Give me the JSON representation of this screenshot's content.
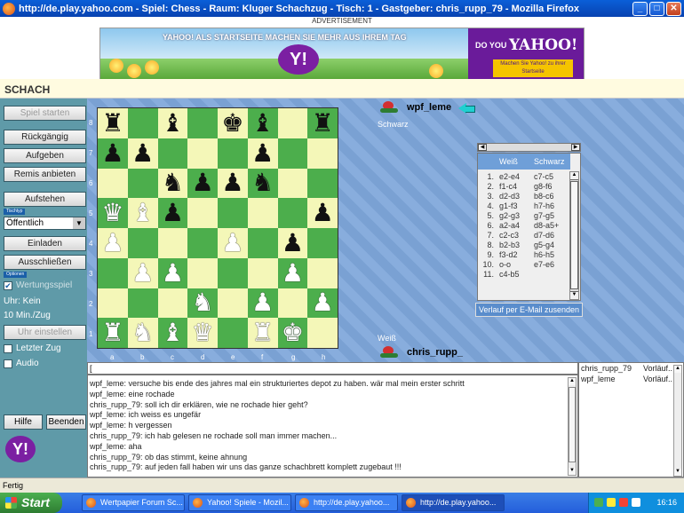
{
  "window": {
    "title": "http://de.play.yahoo.com - Spiel: Chess - Raum: Kluger Schachzug - Tisch: 1 - Gastgeber: chris_rupp_79 - Mozilla Firefox",
    "minimize": "_",
    "maximize": "□",
    "close": "✕"
  },
  "ad": {
    "label": "ADVERTISEMENT",
    "headline": "YAHOO! ALS STARTSEITE MACHEN SIE MEHR AUS IHREM TAG",
    "logo_y": "Y!",
    "doyou": "DO YOU",
    "yahoo": "YAHOO!",
    "cta": "Machen Sie Yahoo! zu ihrer Startseite"
  },
  "section_title": "SCHACH",
  "left_panel": {
    "spiel_starten": "Spiel starten",
    "rueckgaengig": "Rückgängig",
    "aufgeben": "Aufgeben",
    "remis": "Remis anbieten",
    "aufstehen": "Aufstehen",
    "table_tag": "Tischtyp",
    "table_type": "Öffentlich",
    "einladen": "Einladen",
    "ausschliessen": "Ausschließen",
    "options_tag": "Optionen",
    "wertungsspiel": "Wertungsspiel",
    "uhr": "Uhr: Kein",
    "zeit": "10 Min./Zug",
    "uhr_einstellen": "Uhr einstellen",
    "letzter_zug": "Letzter Zug",
    "audio": "Audio",
    "hilfe": "Hilfe",
    "beenden": "Beenden",
    "yahoo_logo": "Y!"
  },
  "board": {
    "ranks": [
      "8",
      "7",
      "6",
      "5",
      "4",
      "3",
      "2",
      "1"
    ],
    "files": [
      "a",
      "b",
      "c",
      "d",
      "e",
      "f",
      "g",
      "h"
    ],
    "rows": [
      [
        "bR",
        "",
        "bB",
        "",
        "bK",
        "bB",
        "",
        "bR"
      ],
      [
        "bP",
        "bP",
        "",
        "",
        "",
        "bP",
        "",
        ""
      ],
      [
        "",
        "",
        "bN",
        "bP",
        "bP",
        "bN",
        "",
        ""
      ],
      [
        "wQ",
        "wB",
        "bP",
        "",
        "",
        "",
        "",
        "bP"
      ],
      [
        "wP",
        "",
        "",
        "",
        "wP",
        "",
        "bP",
        ""
      ],
      [
        "",
        "wP",
        "wP",
        "",
        "",
        "",
        "wP",
        ""
      ],
      [
        "",
        "",
        "",
        "wN",
        "",
        "wP",
        "",
        "wP"
      ],
      [
        "wR",
        "wN",
        "wB",
        "wQ",
        "",
        "wR",
        "wK",
        ""
      ]
    ]
  },
  "players": {
    "top_name": "wpf_leme",
    "top_color": "Schwarz",
    "bottom_name": "chris_rupp_",
    "bottom_color": "Weiß"
  },
  "moves": {
    "header_white": "Weiß",
    "header_black": "Schwarz",
    "list": [
      {
        "n": "1.",
        "w": "e2-e4",
        "b": "c7-c5"
      },
      {
        "n": "2.",
        "w": "f1-c4",
        "b": "g8-f6"
      },
      {
        "n": "3.",
        "w": "d2-d3",
        "b": "b8-c6"
      },
      {
        "n": "4.",
        "w": "g1-f3",
        "b": "h7-h6"
      },
      {
        "n": "5.",
        "w": "g2-g3",
        "b": "g7-g5"
      },
      {
        "n": "6.",
        "w": "a2-a4",
        "b": "d8-a5+"
      },
      {
        "n": "7.",
        "w": "c2-c3",
        "b": "d7-d6"
      },
      {
        "n": "8.",
        "w": "b2-b3",
        "b": "g5-g4"
      },
      {
        "n": "9.",
        "w": "f3-d2",
        "b": "h6-h5"
      },
      {
        "n": "10.",
        "w": "o-o",
        "b": "e7-e6"
      },
      {
        "n": "11.",
        "w": "c4-b5",
        "b": ""
      }
    ],
    "email_button": "Verlauf per E-Mail zusenden"
  },
  "chat": {
    "input_value": "[",
    "lines": [
      "wpf_leme: versuche bis ende des jahres mal ein strukturiertes depot zu haben. wär mal mein erster schritt",
      "wpf_leme: eine rochade",
      "chris_rupp_79: soll ich dir erklären, wie ne rochade hier geht?",
      "wpf_leme: ich weiss es ungefär",
      "wpf_leme: h vergessen",
      "chris_rupp_79: ich hab gelesen ne rochade soll man immer machen...",
      "wpf_leme: aha",
      "chris_rupp_79: ob das stimmt, keine ahnung",
      "chris_rupp_79: auf jeden fall haben wir uns das ganze schachbrett komplett zugebaut !!!"
    ]
  },
  "users": [
    {
      "name": "chris_rupp_79",
      "status": "Vorläuf.."
    },
    {
      "name": "wpf_leme",
      "status": "Vorläuf.."
    }
  ],
  "statusbar": "Fertig",
  "taskbar": {
    "start": "Start",
    "tasks": [
      "Wertpapier Forum Sc...",
      "Yahoo! Spiele - Mozil...",
      "http://de.play.yahoo...",
      "http://de.play.yahoo..."
    ],
    "clock": "16:16"
  }
}
